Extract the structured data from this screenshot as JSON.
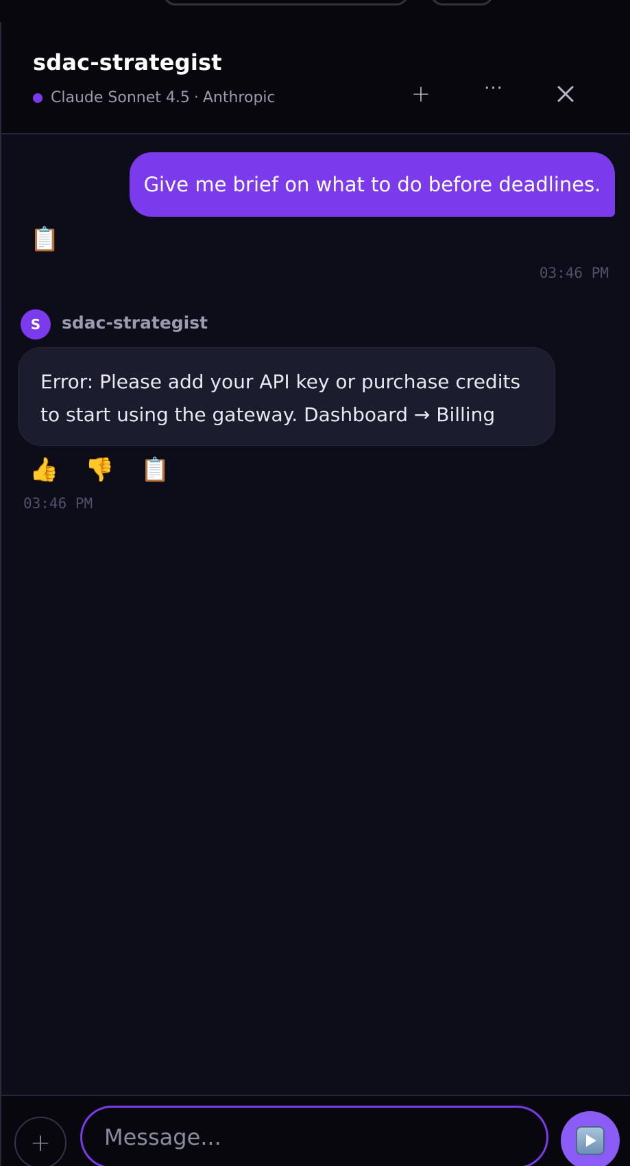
{
  "header": {
    "title": "sdac-strategist",
    "model_name": "Claude Sonnet 4.5",
    "separator": "·",
    "provider": "Anthropic",
    "more_label": "···"
  },
  "conversation": {
    "user_message": {
      "text": "Give me brief on what to do before deadlines.",
      "timestamp": "03:46 PM",
      "copy_emoji": "📋"
    },
    "assistant_message": {
      "avatar_letter": "S",
      "sender": "sdac-strategist",
      "text": "Error: Please add your API key or purchase credits to start using the gateway. Dashboard → Billing",
      "timestamp": "03:46 PM",
      "like_emoji": "👍",
      "dislike_emoji": "👎",
      "copy_emoji": "📋"
    }
  },
  "composer": {
    "attach_label": "+",
    "placeholder": "Message..."
  },
  "colors": {
    "accent": "#7c3aed",
    "background": "#0d0d1a",
    "bubble_bot": "#1b1c2d"
  },
  "icons": [
    "plus-icon",
    "more-icon",
    "close-icon",
    "clipboard-icon",
    "thumbs-up-icon",
    "thumbs-down-icon",
    "send-icon"
  ]
}
